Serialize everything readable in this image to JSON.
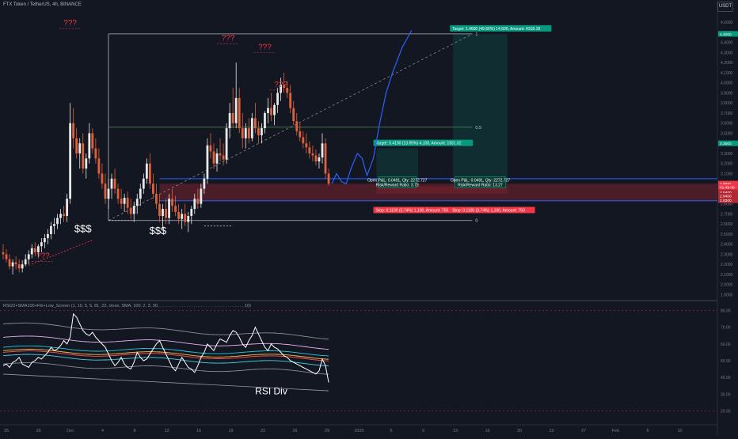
{
  "header": {
    "symbol_title": "FTX Token / TetherUS, 4h, BINANCE",
    "currency": "USDT"
  },
  "indicator": {
    "title": "RSI22+SMA100+Fib+Low_Screen (1, 10, 5, 5, 81, 22, close, SMA, 100, 2, 3, 30, . . . . . . . . . . . . . . . . . . . . . . . . . . . . . . . . . . . 10)"
  },
  "colors": {
    "background": "#131722",
    "up": "#e8e8e8",
    "down": "#e0613a",
    "drawing_red": "#f23645",
    "projection": "#2962ff",
    "target_green": "#089981",
    "stop_red": "#f23645"
  },
  "chart_data": [
    {
      "type": "candlestick",
      "title": "FTX Token / TetherUS, 4h, BINANCE",
      "price_axis_ticks": [
        "4.6000",
        "4.5000",
        "4.4000",
        "4.3000",
        "4.2000",
        "4.1000",
        "4.0000",
        "3.9000",
        "3.8000",
        "3.7000",
        "3.6000",
        "3.5000",
        "3.4000",
        "3.3000",
        "3.2000",
        "3.1000",
        "3.0000",
        "2.9000",
        "2.8000",
        "2.7000",
        "2.6000",
        "2.5000",
        "2.4000",
        "2.3000",
        "2.2000",
        "2.1000",
        "2.0000",
        "1.9000"
      ],
      "ylim": [
        1.88,
        4.68
      ],
      "time_axis_ticks": [
        "25",
        "28",
        "Dec",
        "4",
        "8",
        "12",
        "16",
        "19",
        "22",
        "26",
        "29",
        "2020",
        "6",
        "9",
        "13",
        "16",
        "20",
        "23",
        "27",
        "Feb",
        "6",
        "10"
      ],
      "candles": [
        {
          "o": 2.32,
          "h": 2.4,
          "l": 2.25,
          "c": 2.3
        },
        {
          "o": 2.3,
          "h": 2.35,
          "l": 2.22,
          "c": 2.25
        },
        {
          "o": 2.25,
          "h": 2.3,
          "l": 2.15,
          "c": 2.18
        },
        {
          "o": 2.18,
          "h": 2.25,
          "l": 2.1,
          "c": 2.22
        },
        {
          "o": 2.22,
          "h": 2.28,
          "l": 2.15,
          "c": 2.2
        },
        {
          "o": 2.2,
          "h": 2.25,
          "l": 2.12,
          "c": 2.16
        },
        {
          "o": 2.16,
          "h": 2.24,
          "l": 2.12,
          "c": 2.2
        },
        {
          "o": 2.2,
          "h": 2.3,
          "l": 2.18,
          "c": 2.25
        },
        {
          "o": 2.25,
          "h": 2.34,
          "l": 2.2,
          "c": 2.3
        },
        {
          "o": 2.3,
          "h": 2.4,
          "l": 2.26,
          "c": 2.36
        },
        {
          "o": 2.36,
          "h": 2.42,
          "l": 2.28,
          "c": 2.32
        },
        {
          "o": 2.32,
          "h": 2.4,
          "l": 2.27,
          "c": 2.38
        },
        {
          "o": 2.38,
          "h": 2.46,
          "l": 2.32,
          "c": 2.42
        },
        {
          "o": 2.42,
          "h": 2.5,
          "l": 2.36,
          "c": 2.46
        },
        {
          "o": 2.46,
          "h": 2.55,
          "l": 2.4,
          "c": 2.5
        },
        {
          "o": 2.5,
          "h": 2.62,
          "l": 2.45,
          "c": 2.58
        },
        {
          "o": 2.58,
          "h": 2.66,
          "l": 2.5,
          "c": 2.6
        },
        {
          "o": 2.6,
          "h": 2.7,
          "l": 2.55,
          "c": 2.66
        },
        {
          "o": 2.66,
          "h": 2.75,
          "l": 2.6,
          "c": 2.7
        },
        {
          "o": 2.7,
          "h": 2.78,
          "l": 2.62,
          "c": 2.68
        },
        {
          "o": 2.68,
          "h": 2.9,
          "l": 2.62,
          "c": 2.85
        },
        {
          "o": 2.85,
          "h": 3.8,
          "l": 2.8,
          "c": 3.6
        },
        {
          "o": 3.6,
          "h": 3.75,
          "l": 3.35,
          "c": 3.45
        },
        {
          "o": 3.45,
          "h": 3.55,
          "l": 3.25,
          "c": 3.3
        },
        {
          "o": 3.3,
          "h": 3.45,
          "l": 3.15,
          "c": 3.4
        },
        {
          "o": 3.4,
          "h": 3.5,
          "l": 3.1,
          "c": 3.15
        },
        {
          "o": 3.15,
          "h": 3.3,
          "l": 3.05,
          "c": 3.25
        },
        {
          "o": 3.25,
          "h": 3.6,
          "l": 3.2,
          "c": 3.5
        },
        {
          "o": 3.5,
          "h": 3.55,
          "l": 3.3,
          "c": 3.35
        },
        {
          "o": 3.35,
          "h": 3.45,
          "l": 3.2,
          "c": 3.25
        },
        {
          "o": 3.25,
          "h": 3.35,
          "l": 3.05,
          "c": 3.1
        },
        {
          "o": 3.1,
          "h": 3.2,
          "l": 2.95,
          "c": 3.0
        },
        {
          "o": 3.0,
          "h": 3.1,
          "l": 2.8,
          "c": 2.85
        },
        {
          "o": 2.85,
          "h": 3.05,
          "l": 2.75,
          "c": 2.95
        },
        {
          "o": 2.95,
          "h": 3.1,
          "l": 2.85,
          "c": 3.05
        },
        {
          "o": 3.05,
          "h": 3.15,
          "l": 2.9,
          "c": 2.95
        },
        {
          "o": 2.95,
          "h": 3.0,
          "l": 2.8,
          "c": 2.85
        },
        {
          "o": 2.85,
          "h": 2.95,
          "l": 2.75,
          "c": 2.8
        },
        {
          "o": 2.8,
          "h": 2.9,
          "l": 2.72,
          "c": 2.86
        },
        {
          "o": 2.86,
          "h": 2.92,
          "l": 2.7,
          "c": 2.76
        },
        {
          "o": 2.76,
          "h": 2.85,
          "l": 2.65,
          "c": 2.7
        },
        {
          "o": 2.7,
          "h": 2.82,
          "l": 2.62,
          "c": 2.78
        },
        {
          "o": 2.78,
          "h": 2.9,
          "l": 2.7,
          "c": 2.85
        },
        {
          "o": 2.85,
          "h": 3.0,
          "l": 2.78,
          "c": 2.95
        },
        {
          "o": 2.95,
          "h": 3.1,
          "l": 2.9,
          "c": 3.05
        },
        {
          "o": 3.05,
          "h": 3.25,
          "l": 3.0,
          "c": 3.2
        },
        {
          "o": 3.2,
          "h": 3.3,
          "l": 2.95,
          "c": 3.0
        },
        {
          "o": 3.0,
          "h": 3.1,
          "l": 2.85,
          "c": 2.9
        },
        {
          "o": 2.9,
          "h": 3.0,
          "l": 2.75,
          "c": 2.8
        },
        {
          "o": 2.8,
          "h": 2.9,
          "l": 2.62,
          "c": 2.68
        },
        {
          "o": 2.68,
          "h": 2.8,
          "l": 2.55,
          "c": 2.75
        },
        {
          "o": 2.75,
          "h": 2.85,
          "l": 2.6,
          "c": 2.66
        },
        {
          "o": 2.66,
          "h": 2.9,
          "l": 2.6,
          "c": 2.85
        },
        {
          "o": 2.85,
          "h": 2.95,
          "l": 2.72,
          "c": 2.78
        },
        {
          "o": 2.78,
          "h": 2.88,
          "l": 2.68,
          "c": 2.72
        },
        {
          "o": 2.72,
          "h": 2.8,
          "l": 2.6,
          "c": 2.65
        },
        {
          "o": 2.65,
          "h": 2.75,
          "l": 2.55,
          "c": 2.7
        },
        {
          "o": 2.7,
          "h": 2.8,
          "l": 2.58,
          "c": 2.62
        },
        {
          "o": 2.62,
          "h": 2.72,
          "l": 2.52,
          "c": 2.68
        },
        {
          "o": 2.68,
          "h": 2.78,
          "l": 2.6,
          "c": 2.75
        },
        {
          "o": 2.75,
          "h": 2.9,
          "l": 2.7,
          "c": 2.85
        },
        {
          "o": 2.85,
          "h": 2.95,
          "l": 2.75,
          "c": 2.8
        },
        {
          "o": 2.8,
          "h": 3.0,
          "l": 2.76,
          "c": 2.95
        },
        {
          "o": 2.95,
          "h": 3.1,
          "l": 2.9,
          "c": 3.05
        },
        {
          "o": 3.05,
          "h": 3.45,
          "l": 3.0,
          "c": 3.38
        },
        {
          "o": 3.38,
          "h": 3.5,
          "l": 3.25,
          "c": 3.32
        },
        {
          "o": 3.32,
          "h": 3.4,
          "l": 3.15,
          "c": 3.2
        },
        {
          "o": 3.2,
          "h": 3.35,
          "l": 3.12,
          "c": 3.3
        },
        {
          "o": 3.3,
          "h": 3.45,
          "l": 3.22,
          "c": 3.28
        },
        {
          "o": 3.28,
          "h": 3.4,
          "l": 3.18,
          "c": 3.24
        },
        {
          "o": 3.24,
          "h": 3.6,
          "l": 3.2,
          "c": 3.55
        },
        {
          "o": 3.55,
          "h": 3.8,
          "l": 3.45,
          "c": 3.7
        },
        {
          "o": 3.7,
          "h": 3.95,
          "l": 3.55,
          "c": 3.6
        },
        {
          "o": 3.6,
          "h": 4.2,
          "l": 3.55,
          "c": 3.85
        },
        {
          "o": 3.85,
          "h": 3.95,
          "l": 3.5,
          "c": 3.55
        },
        {
          "o": 3.55,
          "h": 3.7,
          "l": 3.35,
          "c": 3.45
        },
        {
          "o": 3.45,
          "h": 3.6,
          "l": 3.35,
          "c": 3.55
        },
        {
          "o": 3.55,
          "h": 3.65,
          "l": 3.4,
          "c": 3.45
        },
        {
          "o": 3.45,
          "h": 3.7,
          "l": 3.42,
          "c": 3.65
        },
        {
          "o": 3.65,
          "h": 3.8,
          "l": 3.5,
          "c": 3.55
        },
        {
          "o": 3.55,
          "h": 3.62,
          "l": 3.4,
          "c": 3.48
        },
        {
          "o": 3.48,
          "h": 3.6,
          "l": 3.4,
          "c": 3.55
        },
        {
          "o": 3.55,
          "h": 3.72,
          "l": 3.5,
          "c": 3.7
        },
        {
          "o": 3.7,
          "h": 3.85,
          "l": 3.6,
          "c": 3.75
        },
        {
          "o": 3.75,
          "h": 3.9,
          "l": 3.62,
          "c": 3.68
        },
        {
          "o": 3.68,
          "h": 3.8,
          "l": 3.58,
          "c": 3.78
        },
        {
          "o": 3.78,
          "h": 3.95,
          "l": 3.7,
          "c": 3.9
        },
        {
          "o": 3.9,
          "h": 4.05,
          "l": 3.82,
          "c": 3.98
        },
        {
          "o": 3.98,
          "h": 4.1,
          "l": 3.9,
          "c": 3.95
        },
        {
          "o": 3.95,
          "h": 4.02,
          "l": 3.85,
          "c": 3.9
        },
        {
          "o": 3.9,
          "h": 3.98,
          "l": 3.7,
          "c": 3.75
        },
        {
          "o": 3.75,
          "h": 3.82,
          "l": 3.58,
          "c": 3.62
        },
        {
          "o": 3.62,
          "h": 3.7,
          "l": 3.48,
          "c": 3.52
        },
        {
          "o": 3.52,
          "h": 3.6,
          "l": 3.42,
          "c": 3.46
        },
        {
          "o": 3.46,
          "h": 3.52,
          "l": 3.35,
          "c": 3.4
        },
        {
          "o": 3.4,
          "h": 3.5,
          "l": 3.3,
          "c": 3.36
        },
        {
          "o": 3.36,
          "h": 3.42,
          "l": 3.25,
          "c": 3.3
        },
        {
          "o": 3.3,
          "h": 3.38,
          "l": 3.22,
          "c": 3.28
        },
        {
          "o": 3.28,
          "h": 3.34,
          "l": 3.18,
          "c": 3.22
        },
        {
          "o": 3.22,
          "h": 3.3,
          "l": 3.15,
          "c": 3.26
        },
        {
          "o": 3.26,
          "h": 3.5,
          "l": 3.2,
          "c": 3.4
        },
        {
          "o": 3.4,
          "h": 3.45,
          "l": 3.05,
          "c": 3.1
        },
        {
          "o": 3.1,
          "h": 3.15,
          "l": 2.98,
          "c": 3.0
        }
      ],
      "projection": [
        {
          "x": 103,
          "y": 3.0
        },
        {
          "x": 104.5,
          "y": 3.1
        },
        {
          "x": 106,
          "y": 3.02
        },
        {
          "x": 107.5,
          "y": 3.0
        },
        {
          "x": 109,
          "y": 3.15
        },
        {
          "x": 111,
          "y": 3.3
        },
        {
          "x": 112.5,
          "y": 3.25
        },
        {
          "x": 114,
          "y": 3.08
        },
        {
          "x": 116,
          "y": 3.25
        },
        {
          "x": 118,
          "y": 3.6
        },
        {
          "x": 120,
          "y": 3.9
        },
        {
          "x": 122,
          "y": 4.1
        },
        {
          "x": 125,
          "y": 4.35
        },
        {
          "x": 128,
          "y": 4.52
        }
      ],
      "fib_levels": [
        {
          "label": "1",
          "price": 4.485
        },
        {
          "label": "0.5",
          "price": 3.56
        },
        {
          "label": "0",
          "price": 2.635
        }
      ],
      "red_zone": {
        "top": 3.0,
        "bottom": 2.83
      },
      "sub_zone": {
        "top": 2.975,
        "bottom": 2.9
      },
      "blue_lines": [
        3.05,
        2.83
      ],
      "axis_price_labels": [
        {
          "text": "4.4000",
          "price": 4.485
        },
        {
          "text": "3.3500",
          "price": 3.4
        },
        {
          "text": "FTTUSDT",
          "price": 3.0
        },
        {
          "text": "2.9691",
          "price": 3.0
        },
        {
          "text": "01:49:49",
          "price": 2.965
        },
        {
          "text": "2.9400",
          "price": 2.915
        },
        {
          "text": "2.9400",
          "price": 2.88
        },
        {
          "text": "2.8300",
          "price": 2.835
        }
      ],
      "positions": [
        {
          "target": "Target: 0.4100 (13.95%) 4,100, Amount: 1931.82",
          "open": "Open P&L: 0.0491, Qty: 2272.727",
          "rr": "Risk/Reward Ratio: 3.73",
          "stop": "Stop: 0.1100 (3.74%) 1,100, Amount: 750",
          "x_start": 117,
          "x_end": 130,
          "target_price": 3.35
        },
        {
          "target": "Target: 1.4600 (49.66%) 14,600, Amount: 4318.18",
          "open": "Open P&L: 0.0491, Qty: 2272.727",
          "rr": "Risk/Reward Ratio: 13.27",
          "stop": "Stop: 0.1100 (3.74%) 1,100, Amount: 750",
          "x_start": 141,
          "x_end": 158,
          "target_price": 4.485
        }
      ],
      "annotations": [
        {
          "text": "???",
          "x": 21,
          "price": 4.57
        },
        {
          "text": "???",
          "x": 70.5,
          "price": 4.42
        },
        {
          "text": "???",
          "x": 82,
          "price": 4.33
        },
        {
          "text": "???",
          "x": 87,
          "price": 3.96
        },
        {
          "text": "???",
          "x": 12.5,
          "price": 2.26
        },
        {
          "text": "$$$",
          "x": 25,
          "price": 2.52
        },
        {
          "text": "$$$",
          "x": 48.5,
          "price": 2.5
        }
      ]
    },
    {
      "type": "line",
      "title": "RSI22+SMA100+Fib+Low_Screen (1, 10, 5, 5, 81, 22, close, SMA, 100, 2, 3, 30, . . . . . . . . . . . . . . . . . . . . . . . . . . . . . . . . . . . 10)",
      "ylim": [
        15,
        85
      ],
      "y_ticks": [
        "80.00",
        "70.00",
        "60.00",
        "50.00",
        "40.00",
        "30.00",
        "20.00"
      ],
      "hlines": [
        80,
        20
      ],
      "annotation": "RSI Div",
      "rsi": [
        47,
        48,
        46,
        49,
        50,
        52,
        48,
        47,
        46,
        49,
        50,
        52,
        51,
        53,
        55,
        58,
        56,
        57,
        59,
        62,
        60,
        64,
        78,
        76,
        72,
        68,
        66,
        65,
        67,
        64,
        62,
        60,
        58,
        54,
        50,
        47,
        49,
        52,
        48,
        46,
        45,
        49,
        55,
        52,
        50,
        51,
        54,
        57,
        60,
        62,
        58,
        54,
        50,
        46,
        44,
        48,
        52,
        49,
        46,
        45,
        43,
        47,
        52,
        55,
        60,
        58,
        56,
        60,
        63,
        62,
        61,
        65,
        68,
        67,
        64,
        60,
        58,
        62,
        65,
        70,
        66,
        62,
        58,
        56,
        60,
        58,
        57,
        55,
        53,
        52,
        50,
        49,
        48,
        47,
        46,
        45,
        44,
        43,
        42,
        44,
        51,
        47,
        37
      ],
      "bands": [
        {
          "color": "#8a8d98",
          "start": 72,
          "end": 64
        },
        {
          "color": "#e9b2f0",
          "start": 64,
          "end": 58
        },
        {
          "color": "#26c6da",
          "start": 58,
          "end": 54
        },
        {
          "color": "#f6c04e",
          "start": 56,
          "end": 52
        },
        {
          "color": "#ff5252",
          "start": 55,
          "end": 51
        },
        {
          "color": "#4dd0e1",
          "start": 53,
          "end": 48
        },
        {
          "color": "#8a8d98",
          "start": 48,
          "end": 43
        }
      ]
    }
  ]
}
